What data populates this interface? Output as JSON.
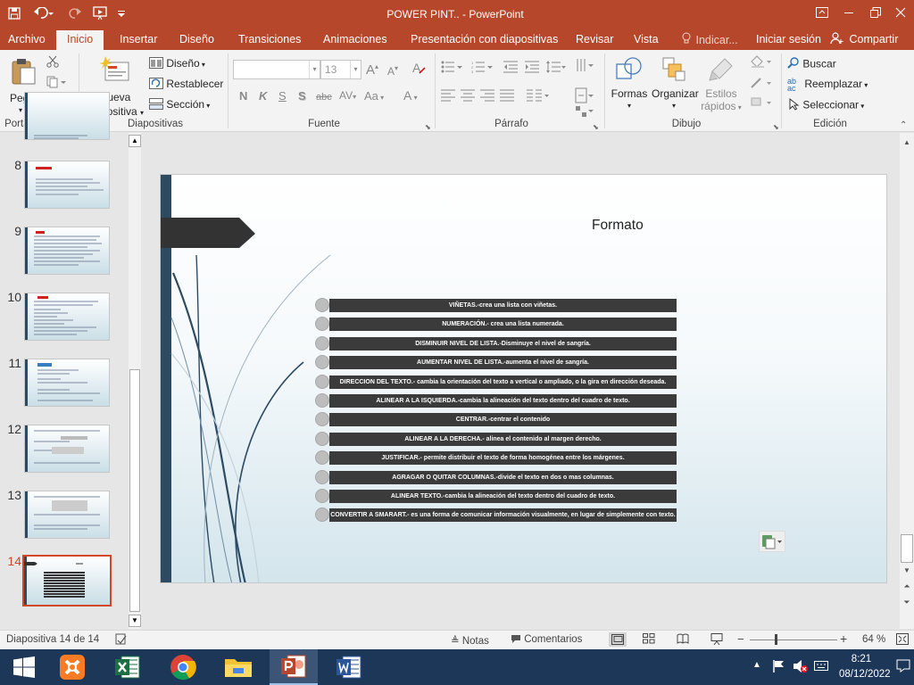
{
  "window": {
    "title": "POWER PINT.. - PowerPoint"
  },
  "tabs": {
    "file": "Archivo",
    "home": "Inicio",
    "insert": "Insertar",
    "design": "Diseño",
    "transitions": "Transiciones",
    "animations": "Animaciones",
    "slideshow": "Presentación con diapositivas",
    "review": "Revisar",
    "view": "Vista",
    "tell_me": "Indicar...",
    "signin": "Iniciar sesión",
    "share": "Compartir"
  },
  "ribbon": {
    "clipboard": {
      "label": "Portapapeles",
      "paste": "Pegar"
    },
    "slides": {
      "label": "Diapositivas",
      "new_slide_1": "Nueva",
      "new_slide_2": "diapositiva",
      "layout": "Diseño",
      "reset": "Restablecer",
      "section": "Sección"
    },
    "font": {
      "label": "Fuente",
      "font_name": "",
      "font_size": "13",
      "bold": "N",
      "italic": "K",
      "underline": "S",
      "shadow": "S",
      "strike": "abc",
      "case": "Aa"
    },
    "paragraph": {
      "label": "Párrafo"
    },
    "drawing": {
      "label": "Dibujo",
      "shapes": "Formas",
      "arrange": "Organizar",
      "quick_styles_1": "Estilos",
      "quick_styles_2": "rápidos"
    },
    "editing": {
      "label": "Edición",
      "find": "Buscar",
      "replace": "Reemplazar",
      "select": "Seleccionar"
    }
  },
  "thumbnails": [
    {
      "number": "8"
    },
    {
      "number": "9"
    },
    {
      "number": "10"
    },
    {
      "number": "11"
    },
    {
      "number": "12"
    },
    {
      "number": "13"
    },
    {
      "number": "14"
    }
  ],
  "slide": {
    "title": "Formato",
    "items": [
      "VIÑETAS.-crea una lista con viñetas.",
      "NUMERACIÓN.- crea una lista numerada.",
      "DISMINUIR NIVEL DE LISTA.-Disminuye el nivel de sangría.",
      "AUMENTAR NIVEL DE LISTA.-aumenta el nivel de sangría.",
      "DIRECCION DEL TEXTO.- cambia la orientación del texto a vertical o ampliado, o la gira en dirección deseada.",
      "ALINEAR A LA ISQUIERDA.-cambia la alineación del texto dentro del cuadro de texto.",
      "CENTRAR.-centrar el contenido",
      "ALINEAR A LA DERECHA.- alinea el contenido al margen  derecho.",
      "JUSTIFICAR.- permite distribuir el texto de forma homogénea entre los márgenes.",
      "AGRAGAR O QUITAR COLUMNAS.-divide el texto en dos o mas columnas.",
      "ALINEAR TEXTO.-cambia la alineación del texto dentro del cuadro de texto.",
      "CONVERTIR A SMARART.- es una forma de comunicar información visualmente, en lugar de simplemente con  texto."
    ]
  },
  "status": {
    "slide_counter": "Diapositiva 14 de 14",
    "notes": "Notas",
    "comments": "Comentarios",
    "zoom": "64 %"
  },
  "taskbar": {
    "time": "8:21",
    "date": "08/12/2022"
  },
  "colors": {
    "accent": "#b7472a",
    "taskbar": "#1c3757",
    "slide_bar": "#3b3b3b",
    "sidebar_stripe": "#2d4a63"
  }
}
